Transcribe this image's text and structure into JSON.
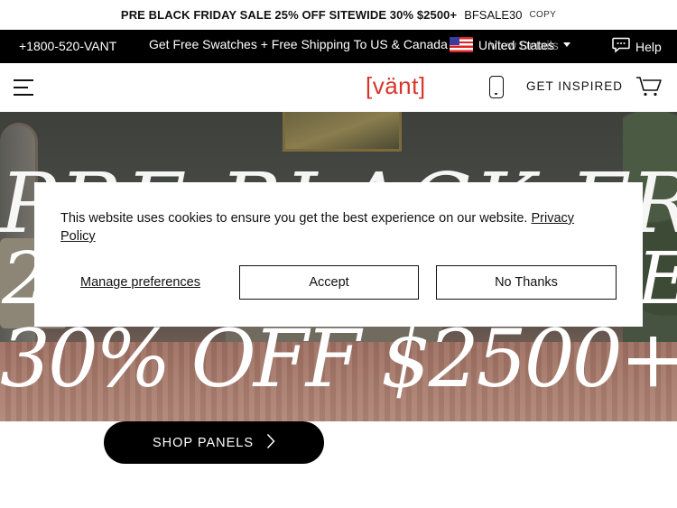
{
  "promo": {
    "headline": "PRE BLACK FRIDAY SALE 25% OFF SITEWIDE 30% $2500+",
    "code": "BFSALE30",
    "copy_label": "COPY"
  },
  "infobar": {
    "phone": "+1800-520-VANT",
    "shipping": "Get Free Swatches + Free Shipping To US & Canada",
    "shipping_tail": "View Details",
    "country": "United States",
    "help": "Help"
  },
  "header": {
    "logo": "[vänt]",
    "get_inspired": "GET INSPIRED"
  },
  "hero": {
    "line1": "PRE BLACK FRIDAY",
    "left_fragment": "2",
    "right_fragment": "E",
    "line2": "30% OFF $2500+."
  },
  "cookie": {
    "message": "This website uses cookies to ensure you get the best experience on our website.",
    "policy_link": "Privacy Policy",
    "manage": "Manage preferences",
    "accept": "Accept",
    "decline": "No Thanks"
  },
  "cta": {
    "shop": "SHOP PANELS"
  },
  "colors": {
    "brand": "#d9342b",
    "bar": "#000000"
  }
}
